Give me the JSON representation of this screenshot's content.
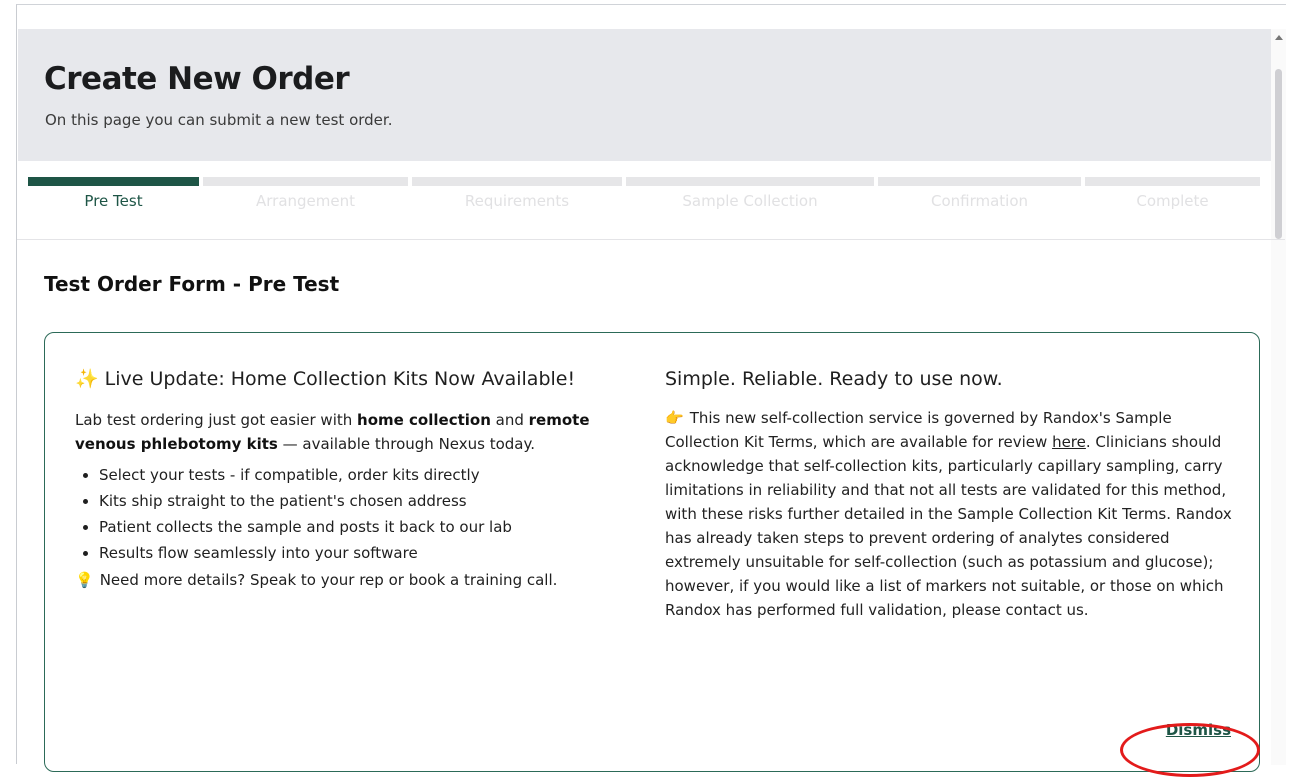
{
  "page": {
    "title": "Create New Order",
    "subtitle": "On this page you can submit a new test order."
  },
  "steps": [
    {
      "label": "Pre Test",
      "active": true
    },
    {
      "label": "Arrangement",
      "active": false
    },
    {
      "label": "Requirements",
      "active": false
    },
    {
      "label": "Sample Collection",
      "active": false
    },
    {
      "label": "Confirmation",
      "active": false
    },
    {
      "label": "Complete",
      "active": false
    }
  ],
  "form": {
    "title": "Test Order Form - Pre Test"
  },
  "announcement": {
    "left": {
      "heading": "Live Update: Home Collection Kits Now Available!",
      "intro_1": "Lab test ordering just got easier with ",
      "intro_bold_1": "home collection",
      "intro_2": " and ",
      "intro_bold_2": "remote venous phlebotomy kits",
      "intro_3": " — available through Nexus today.",
      "bullets": [
        "Select your tests - if compatible, order kits directly",
        "Kits ship straight to the patient's chosen address",
        "Patient collects the sample and posts it back to our lab",
        "Results flow seamlessly into your software"
      ],
      "tip": "Need more details? Speak to your rep or book a training call."
    },
    "right": {
      "heading": "Simple. Reliable. Ready to use now.",
      "body_1": "This new self-collection service is governed by Randox's Sample Collection Kit Terms, which are available for review ",
      "link_text": "here",
      "body_2": ". Clinicians should acknowledge that self-collection kits, particularly capillary sampling, carry limitations in reliability and that not all tests are validated for this method, with these risks further detailed in the Sample Collection Kit Terms. Randox has already taken steps to prevent ordering of analytes considered extremely unsuitable for self-collection (such as potassium and glucose); however, if you would like a list of markers not suitable, or those on which Randox has performed full validation, please contact us."
    },
    "dismiss_label": "Dismiss"
  },
  "colors": {
    "accent": "#1e5546",
    "header_bg": "#e7e8ec",
    "annotation": "#e31b1b"
  }
}
